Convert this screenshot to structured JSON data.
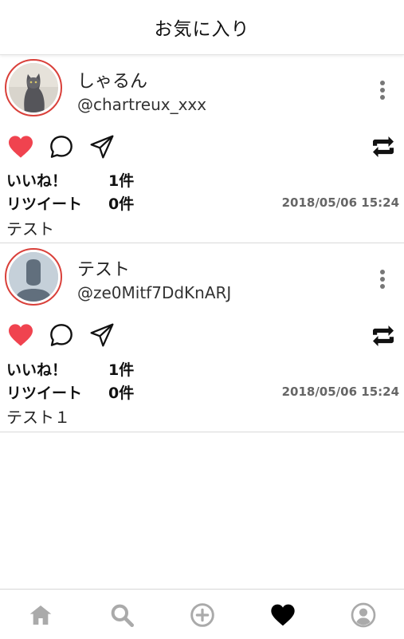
{
  "header": {
    "title": "お気に入り"
  },
  "posts": [
    {
      "name": "しゃるん",
      "handle": "@chartreux_xxx",
      "avatar": "cat-photo",
      "likes_label": "いいね！",
      "likes_value": "1件",
      "retweets_label": "リツイート",
      "retweets_value": "0件",
      "timestamp": "2018/05/06 15:24",
      "text": "テスト"
    },
    {
      "name": "テスト",
      "handle": "@ze0Mitf7DdKnARJ",
      "avatar": "default-user",
      "likes_label": "いいね！",
      "likes_value": "1件",
      "retweets_label": "リツイート",
      "retweets_value": "0件",
      "timestamp": "2018/05/06 15:24",
      "text": "テスト１"
    }
  ],
  "colors": {
    "like": "#f0434f",
    "avatar_border": "#d9403a",
    "nav_inactive": "#aaaaaa",
    "nav_active": "#000000"
  },
  "bottom_nav": [
    "home-icon",
    "search-icon",
    "add-circle-icon",
    "heart-icon",
    "profile-icon"
  ]
}
